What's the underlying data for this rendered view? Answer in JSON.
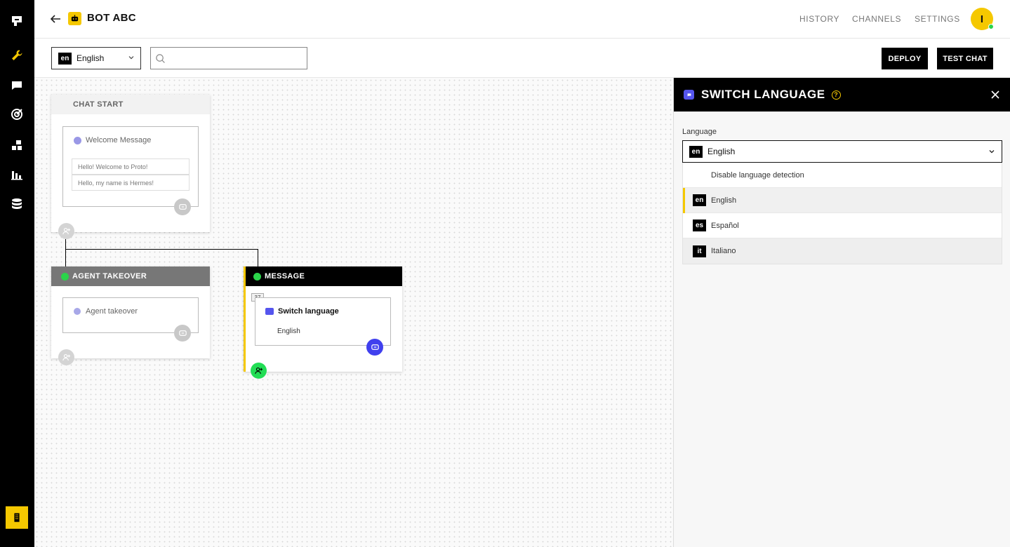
{
  "header": {
    "bot_title": "BOT ABC",
    "nav": [
      "HISTORY",
      "CHANNELS",
      "SETTINGS"
    ],
    "avatar_initial": "I"
  },
  "toolbar": {
    "language": {
      "code": "en",
      "label": "English"
    },
    "search_value": "",
    "deploy_label": "DEPLOY",
    "test_chat_label": "TEST CHAT"
  },
  "canvas": {
    "chat_start": {
      "title": "CHAT START",
      "card_title": "Welcome Message",
      "messages": [
        "Hello! Welcome to Proto!",
        "Hello, my name is Hermes!"
      ]
    },
    "agent_takeover": {
      "title": "AGENT TAKEOVER",
      "card_title": "Agent takeover"
    },
    "message": {
      "title": "MESSAGE",
      "badge": "37",
      "card_title": "Switch language",
      "card_value": "English"
    }
  },
  "panel": {
    "title": "SWITCH LANGUAGE",
    "help": "?",
    "field_label": "Language",
    "selected": {
      "code": "en",
      "label": "English"
    },
    "options": [
      {
        "code": "",
        "label": "Disable language detection"
      },
      {
        "code": "en",
        "label": "English"
      },
      {
        "code": "es",
        "label": "Español"
      },
      {
        "code": "it",
        "label": "Italiano"
      }
    ]
  },
  "colors": {
    "accent": "#f5c800",
    "success": "#22dd55",
    "primary_blue": "#4444ee",
    "node_gray": "#777777"
  }
}
